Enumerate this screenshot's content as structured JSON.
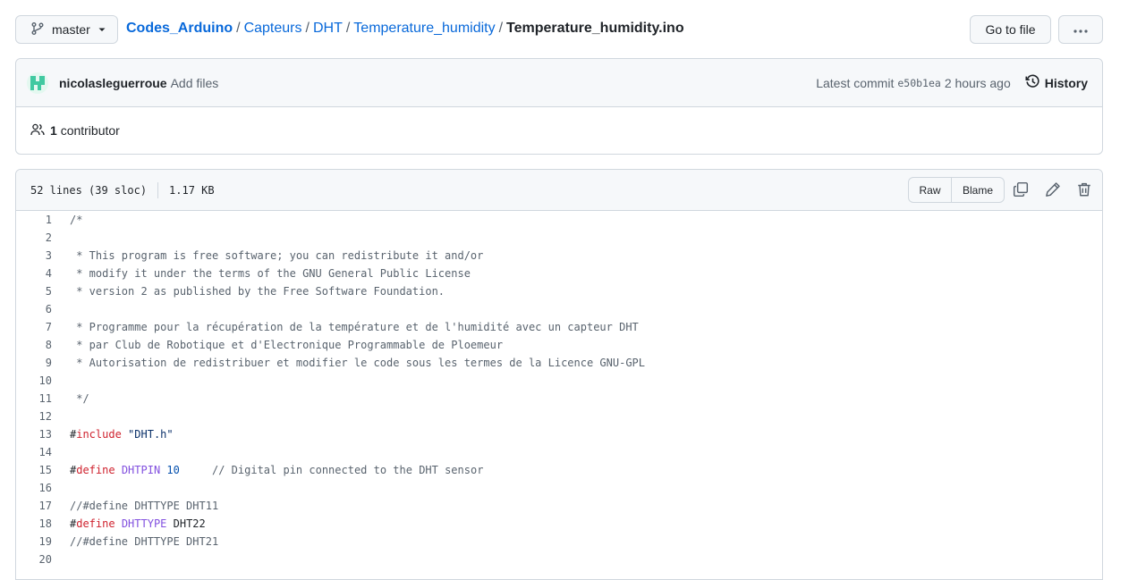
{
  "branch": {
    "name": "master"
  },
  "breadcrumb": {
    "repo": "Codes_Arduino",
    "parts": [
      "Capteurs",
      "DHT",
      "Temperature_humidity"
    ],
    "file": "Temperature_humidity.ino",
    "separator": "/"
  },
  "actions": {
    "go_to_file": "Go to file",
    "more": "···"
  },
  "commit": {
    "author": "nicolasleguerroue",
    "message": "Add files",
    "latest_label": "Latest commit",
    "sha": "e50b1ea",
    "time": "2 hours ago",
    "history_label": "History"
  },
  "contributors": {
    "count": "1",
    "label": "contributor"
  },
  "file_info": {
    "lines": "52 lines (39 sloc)",
    "size": "1.17 KB",
    "raw_label": "Raw",
    "blame_label": "Blame"
  },
  "code_lines": [
    {
      "n": "1",
      "text": "/*"
    },
    {
      "n": "2",
      "text": ""
    },
    {
      "n": "3",
      "text": " * This program is free software; you can redistribute it and/or"
    },
    {
      "n": "4",
      "text": " * modify it under the terms of the GNU General Public License"
    },
    {
      "n": "5",
      "text": " * version 2 as published by the Free Software Foundation."
    },
    {
      "n": "6",
      "text": ""
    },
    {
      "n": "7",
      "text": " * Programme pour la récupération de la température et de l'humidité avec un capteur DHT"
    },
    {
      "n": "8",
      "text": " * par Club de Robotique et d'Electronique Programmable de Ploemeur"
    },
    {
      "n": "9",
      "text": " * Autorisation de redistribuer et modifier le code sous les termes de la Licence GNU-GPL"
    },
    {
      "n": "10",
      "text": ""
    },
    {
      "n": "11",
      "text": " */"
    },
    {
      "n": "12",
      "text": ""
    },
    {
      "n": "13",
      "text": "#include \"DHT.h\""
    },
    {
      "n": "14",
      "text": ""
    },
    {
      "n": "15",
      "text": "#define DHTPIN 10     // Digital pin connected to the DHT sensor"
    },
    {
      "n": "16",
      "text": ""
    },
    {
      "n": "17",
      "text": "//#define DHTTYPE DHT11"
    },
    {
      "n": "18",
      "text": "#define DHTTYPE DHT22"
    },
    {
      "n": "19",
      "text": "//#define DHTTYPE DHT21"
    },
    {
      "n": "20",
      "text": ""
    }
  ]
}
